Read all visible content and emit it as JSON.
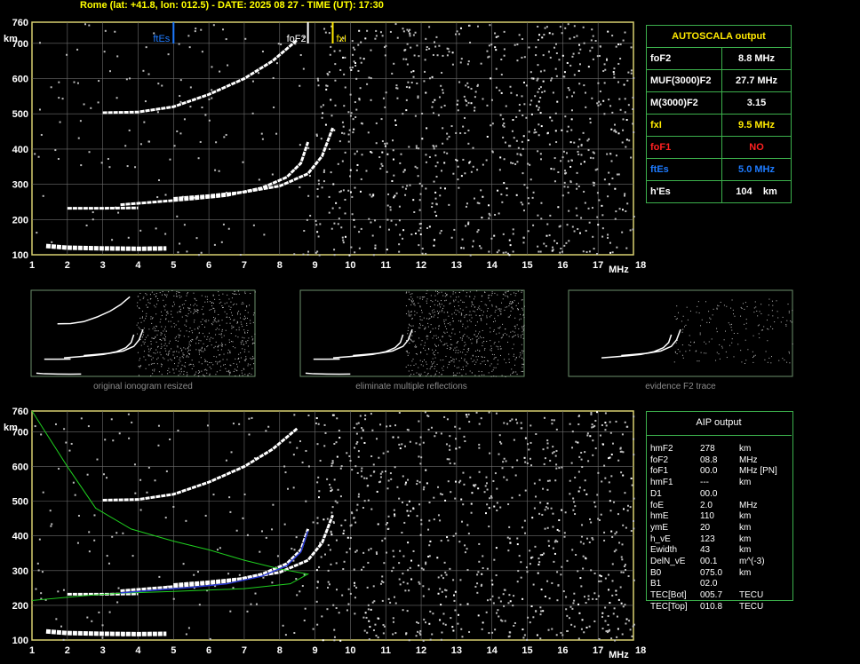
{
  "title": "Rome (lat: +41.8, lon: 012.5) - DATE: 2025 08 27 - TIME (UT): 17:30",
  "colors": {
    "grid": "#6e6e6e",
    "frame": "#d8d070",
    "trace": "#ffffff",
    "noise": "#bdbdbd",
    "fxI": "#ffea00",
    "ftEs": "#1e7bff",
    "foF1": "#ff2020",
    "table_border": "#3cb04c",
    "profile": "#1fd01f",
    "aip_trace": "#2b3bd6"
  },
  "axes": {
    "y_unit": "km",
    "x_unit": "MHz",
    "y_ticks": [
      "760",
      "700",
      "600",
      "500",
      "400",
      "300",
      "200",
      "100"
    ],
    "x_ticks": [
      "1",
      "2",
      "3",
      "4",
      "5",
      "6",
      "7",
      "8",
      "9",
      "10",
      "11",
      "12",
      "13",
      "14",
      "15",
      "16",
      "17",
      "18"
    ]
  },
  "markers": {
    "ftEs": "ftEs",
    "foF2": "foF2",
    "fxI": "fxI"
  },
  "chart_data": {
    "type": "scatter",
    "title": "Rome (lat: +41.8, lon: 012.5) - DATE: 2025 08 27 - TIME (UT): 17:30",
    "xlabel": "MHz",
    "ylabel": "km",
    "xlim": [
      1,
      18
    ],
    "ylim": [
      100,
      760
    ],
    "grid": true,
    "markers": [
      {
        "name": "ftEs",
        "x": 5.0
      },
      {
        "name": "foF2",
        "x": 8.8
      },
      {
        "name": "fxI",
        "x": 9.5
      }
    ],
    "traces": [
      {
        "name": "Es",
        "x": [
          1.4,
          2.0,
          3.0,
          4.0,
          4.8
        ],
        "y": [
          125,
          120,
          118,
          117,
          118
        ]
      },
      {
        "name": "F2 o-mode",
        "x": [
          3.5,
          4.5,
          5.5,
          6.5,
          7.5,
          8.2,
          8.6,
          8.8
        ],
        "y": [
          242,
          250,
          258,
          268,
          290,
          320,
          360,
          420
        ]
      },
      {
        "name": "F2 x-mode",
        "x": [
          5.0,
          6.0,
          7.0,
          8.0,
          8.8,
          9.2,
          9.5
        ],
        "y": [
          260,
          268,
          278,
          295,
          330,
          380,
          460
        ]
      },
      {
        "name": "2F2",
        "x": [
          3.0,
          4.0,
          5.0,
          6.0,
          7.0,
          7.8,
          8.5
        ],
        "y": [
          503,
          505,
          520,
          555,
          600,
          650,
          710
        ]
      },
      {
        "name": "2Es",
        "x": [
          2.0,
          3.0,
          4.0
        ],
        "y": [
          232,
          232,
          233
        ]
      }
    ],
    "profile": {
      "name": "electron density profile",
      "x": [
        1.0,
        2.0,
        2.8,
        3.8,
        5.0,
        6.0,
        7.0,
        8.0,
        8.8,
        8.3,
        7.0,
        5.0,
        3.5,
        2.5,
        1.0
      ],
      "y": [
        760,
        600,
        480,
        420,
        385,
        360,
        330,
        305,
        290,
        262,
        248,
        240,
        235,
        228,
        214
      ]
    }
  },
  "thumbnails": {
    "captions": [
      "original ionogram resized",
      "eliminate multiple reflections",
      "evidence F2 trace"
    ]
  },
  "autoscala": {
    "header": "AUTOSCALA output",
    "rows": [
      {
        "label": "foF2",
        "value": "8.8 MHz",
        "color": "#ffffff"
      },
      {
        "label": "MUF(3000)F2",
        "value": "27.7 MHz",
        "color": "#ffffff"
      },
      {
        "label": "M(3000)F2",
        "value": "3.15",
        "color": "#ffffff"
      },
      {
        "label": "fxI",
        "value": "9.5 MHz",
        "color": "#ffea00"
      },
      {
        "label": "foF1",
        "value": "NO",
        "color": "#ff2020"
      },
      {
        "label": "ftEs",
        "value": "5.0 MHz",
        "color": "#1e7bff"
      },
      {
        "label": "h'Es",
        "value": "104    km",
        "color": "#ffffff"
      }
    ]
  },
  "aip": {
    "header": "AIP output",
    "rows": [
      {
        "label": "hmF2",
        "value": "278",
        "unit": "km"
      },
      {
        "label": "foF2",
        "value": "08.8",
        "unit": "MHz"
      },
      {
        "label": "foF1",
        "value": "00.0",
        "unit": "MHz  [PN]"
      },
      {
        "label": "hmF1",
        "value": "---",
        "unit": "km"
      },
      {
        "label": "D1",
        "value": "00.0",
        "unit": ""
      },
      {
        "label": "foE",
        "value": "2.0",
        "unit": "MHz"
      },
      {
        "label": "hmE",
        "value": "110",
        "unit": "km"
      },
      {
        "label": "ymE",
        "value": "20",
        "unit": "km"
      },
      {
        "label": "h_vE",
        "value": "123",
        "unit": "km"
      },
      {
        "label": "Ewidth",
        "value": "43",
        "unit": "km"
      },
      {
        "label": "DelN_vE",
        "value": "00.1",
        "unit": "m^(-3)"
      },
      {
        "label": "B0",
        "value": "075.0",
        "unit": "km"
      },
      {
        "label": "B1",
        "value": "02.0",
        "unit": ""
      },
      {
        "label": "TEC[Bot]",
        "value": "005.7",
        "unit": "TECU"
      },
      {
        "label": "TEC[Top]",
        "value": "010.8",
        "unit": "TECU"
      }
    ]
  }
}
